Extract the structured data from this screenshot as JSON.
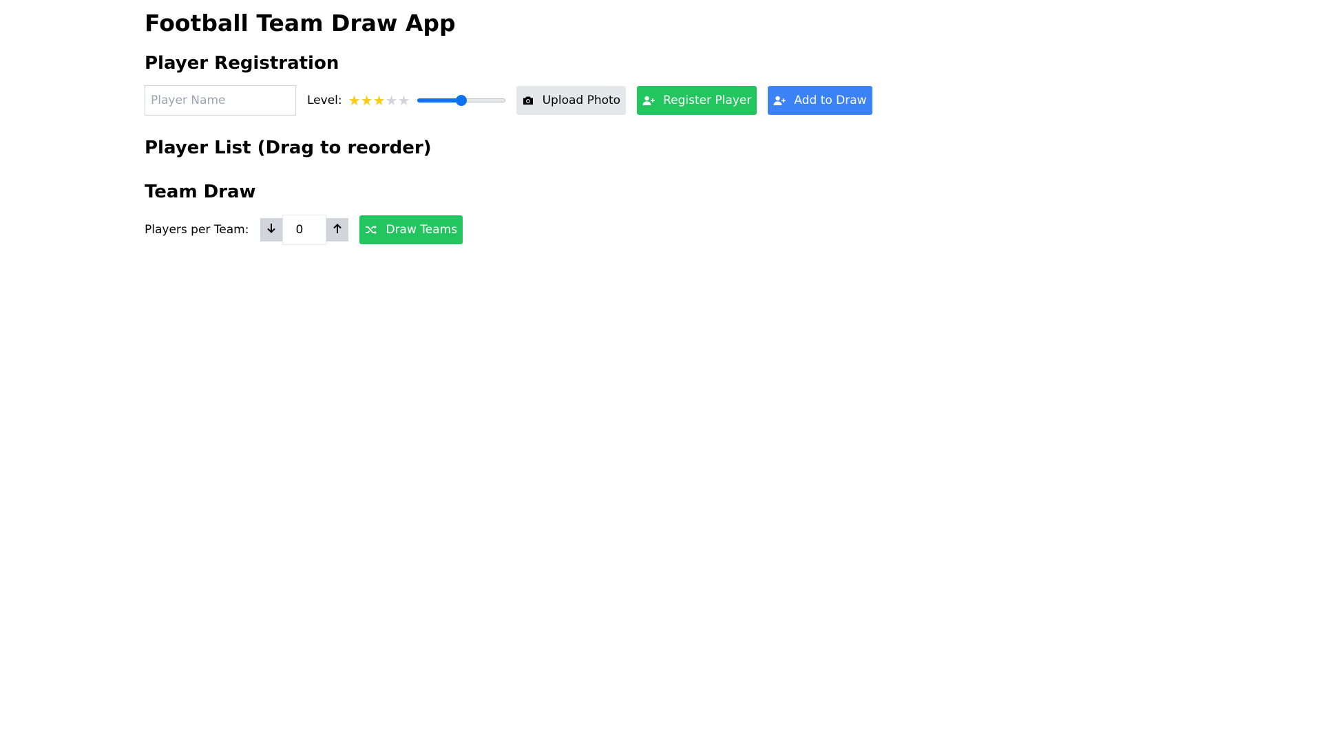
{
  "app": {
    "title": "Football Team Draw App"
  },
  "registration": {
    "heading": "Player Registration",
    "name_placeholder": "Player Name",
    "name_value": "",
    "level_label": "Level:",
    "level_stars": 3,
    "level_max": 5,
    "level_slider_fraction": 0.5,
    "upload_label": "Upload Photo",
    "register_label": "Register Player",
    "add_to_draw_label": "Add to Draw"
  },
  "player_list": {
    "heading": "Player List (Drag to reorder)"
  },
  "team_draw": {
    "heading": "Team Draw",
    "players_per_team_label": "Players per Team:",
    "players_per_team_value": "0",
    "draw_label": "Draw Teams"
  },
  "icons": {
    "upload": "camera-icon",
    "register": "user-plus-icon",
    "add_to_draw": "user-plus-icon",
    "decrement": "arrow-down-icon",
    "increment": "arrow-up-icon",
    "draw": "shuffle-icon"
  },
  "colors": {
    "star_active": "#facc15",
    "star_inactive": "#d1d5db",
    "slider": "#0a74f0",
    "green": "#22c55e",
    "blue": "#3b82f6",
    "gray": "#e5e7eb"
  }
}
